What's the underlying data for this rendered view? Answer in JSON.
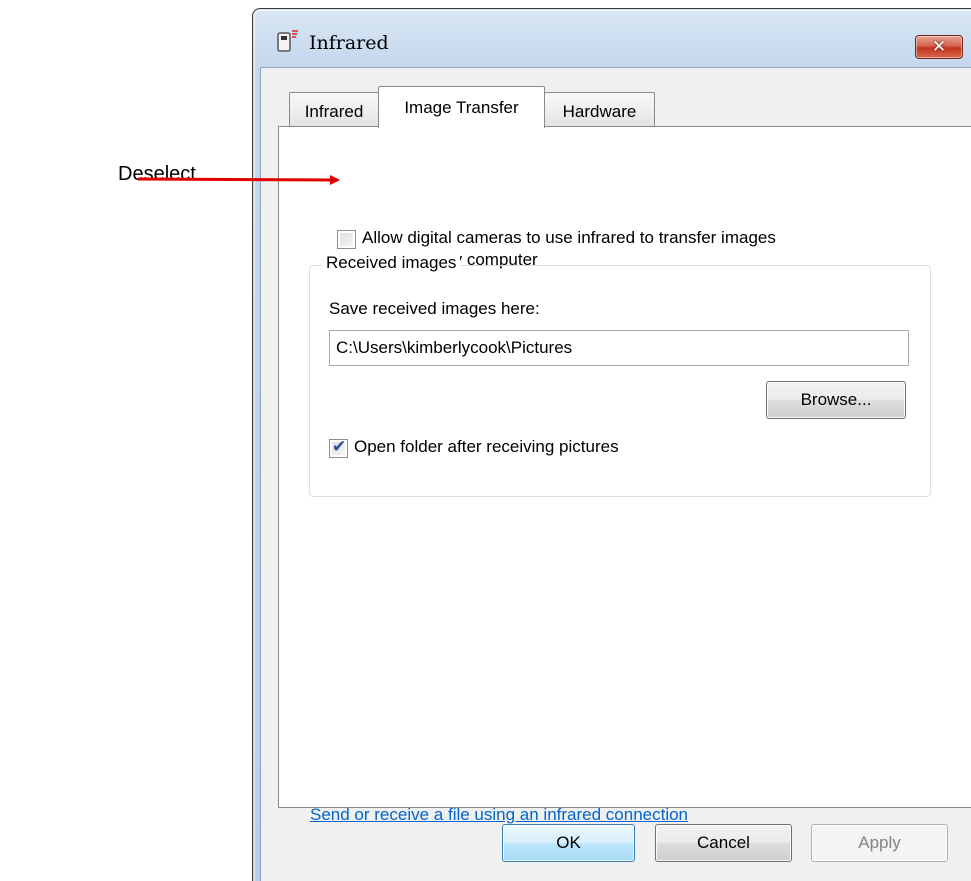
{
  "annotation": {
    "label": "Deselect",
    "arrow_color": "#e00000"
  },
  "window": {
    "title": "Infrared",
    "close_glyph": "✕"
  },
  "tabs": [
    {
      "label": "Infrared",
      "active": false
    },
    {
      "label": "Image Transfer",
      "active": true
    },
    {
      "label": "Hardware",
      "active": false
    }
  ],
  "image_transfer": {
    "allow_checkbox_checked": false,
    "allow_label_line1": "Allow digital cameras to use infrared to transfer images",
    "allow_label_line2": "directly to my computer",
    "group_title": "Received images",
    "save_label": "Save received images here:",
    "save_path": "C:\\Users\\kimberlycook\\Pictures",
    "browse_label": "Browse...",
    "open_folder_checked": true,
    "open_folder_label": "Open folder after receiving pictures",
    "link_text": "Send or receive a file using an infrared connection"
  },
  "buttons": {
    "ok": "OK",
    "cancel": "Cancel",
    "apply": "Apply"
  },
  "colors": {
    "link": "#0066cc",
    "close_button": "#c2351c",
    "checkmark": "#2a4f9a"
  },
  "icons": {
    "title": "infrared-port-icon",
    "close": "close-icon",
    "checkmark": "checkmark-icon"
  }
}
